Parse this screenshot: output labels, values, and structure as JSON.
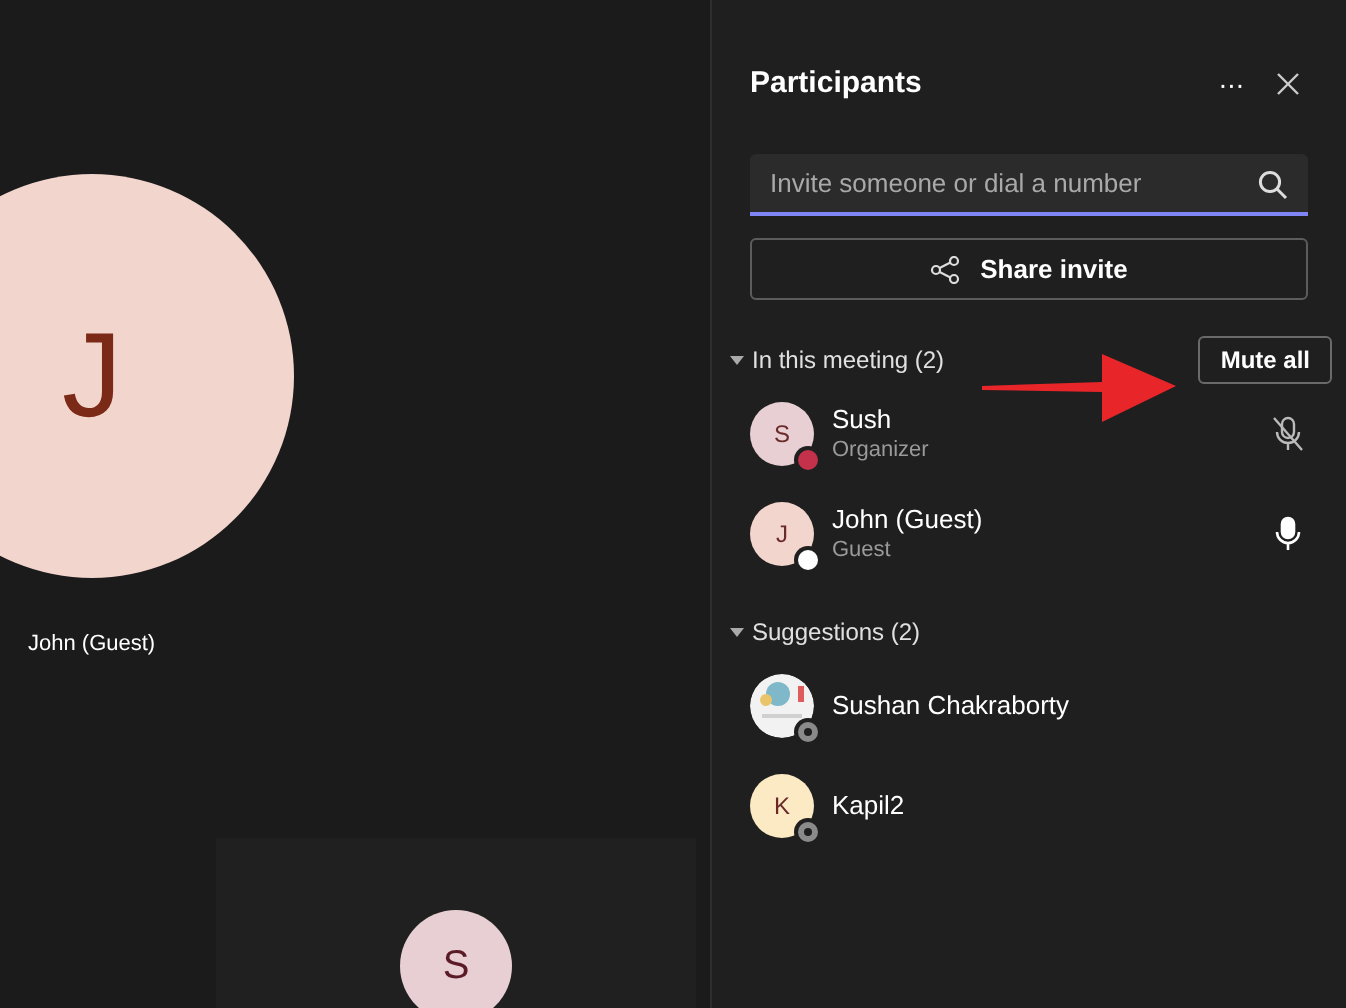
{
  "stage": {
    "main_tile": {
      "initial": "J",
      "name": "John (Guest)",
      "color": "#f2d5cc"
    },
    "small_tile": {
      "initial": "S",
      "color": "#e8cfd3"
    }
  },
  "panel": {
    "title": "Participants",
    "more": "···",
    "search": {
      "placeholder": "Invite someone or dial a number"
    },
    "share_button": "Share invite",
    "sections": [
      {
        "title": "In this meeting (2)",
        "expanded": true,
        "action": "Mute all",
        "people": [
          {
            "name": "Sush",
            "role": "Organizer",
            "initial": "S",
            "color": "#e8cfd3",
            "badge": {
              "kind": "dot",
              "color": "#c4314b"
            },
            "mic": {
              "muted": true
            }
          },
          {
            "name": "John (Guest)",
            "role": "Guest",
            "initial": "J",
            "color": "#f2d5cc",
            "badge": {
              "kind": "dot",
              "color": "#ffffff"
            },
            "mic": {
              "muted": false
            }
          }
        ]
      },
      {
        "title": "Suggestions (2)",
        "expanded": true,
        "people": [
          {
            "name": "Sushan Chakraborty",
            "kind": "picture",
            "badge": {
              "kind": "ring",
              "color": "#8a8a8a"
            }
          },
          {
            "name": "Kapil2",
            "initial": "K",
            "color": "#fbeac4",
            "badge": {
              "kind": "ring",
              "color": "#8a8a8a"
            }
          }
        ]
      }
    ]
  }
}
